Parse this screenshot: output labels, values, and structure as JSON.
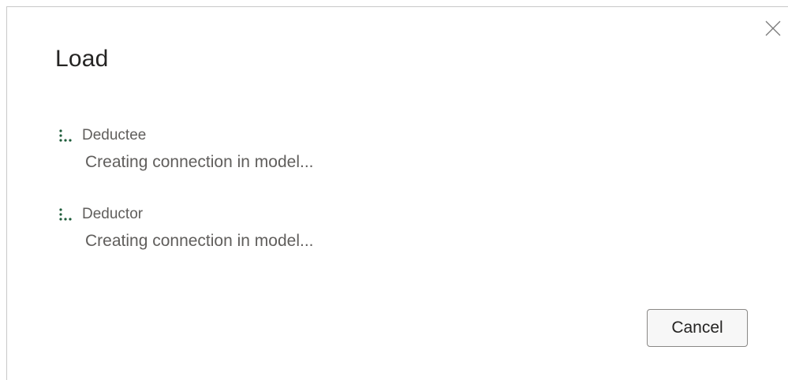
{
  "dialog": {
    "title": "Load",
    "close_icon": "close-icon",
    "items": [
      {
        "name": "Deductee",
        "status": "Creating connection in model...",
        "icon": "loading-spinner-icon"
      },
      {
        "name": "Deductor",
        "status": "Creating connection in model...",
        "icon": "loading-spinner-icon"
      }
    ],
    "cancel_label": "Cancel"
  },
  "colors": {
    "spinner": "#1e5c3a",
    "title": "#252423",
    "secondary_text": "#605e5c",
    "button_border": "#8a8886"
  }
}
